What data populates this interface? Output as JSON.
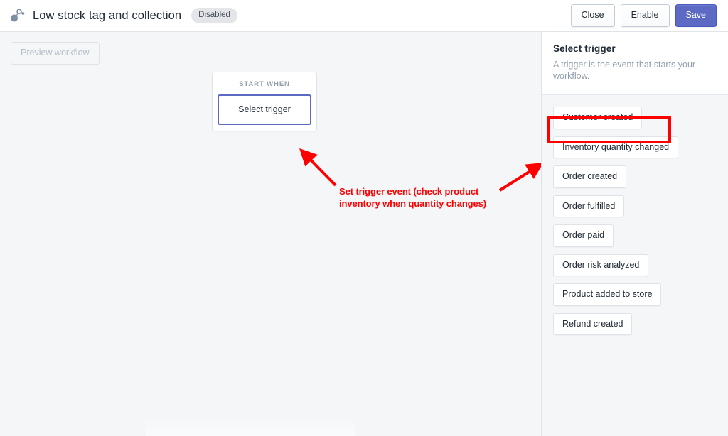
{
  "topbar": {
    "icon": "workflow-node-icon",
    "title": "Low stock tag and collection",
    "status_badge": "Disabled",
    "buttons": {
      "close": "Close",
      "enable": "Enable",
      "save": "Save"
    },
    "accent_color": "#5c6ac4"
  },
  "canvas": {
    "preview_button": "Preview workflow",
    "node": {
      "header": "START WHEN",
      "select_label": "Select trigger",
      "border_color": "#5c6ac4"
    },
    "annotation": {
      "text": "Set trigger event (check product inventory when quantity changes)",
      "color": "#ff0000"
    }
  },
  "panel": {
    "title": "Select trigger",
    "description": "A trigger is the event that starts your workflow.",
    "triggers": [
      {
        "label": "Customer created",
        "highlighted": false
      },
      {
        "label": "Inventory quantity changed",
        "highlighted": true
      },
      {
        "label": "Order created",
        "highlighted": false
      },
      {
        "label": "Order fulfilled",
        "highlighted": false
      },
      {
        "label": "Order paid",
        "highlighted": false
      },
      {
        "label": "Order risk analyzed",
        "highlighted": false
      },
      {
        "label": "Product added to store",
        "highlighted": false
      },
      {
        "label": "Refund created",
        "highlighted": false
      }
    ],
    "highlight_color": "#ff0000"
  }
}
